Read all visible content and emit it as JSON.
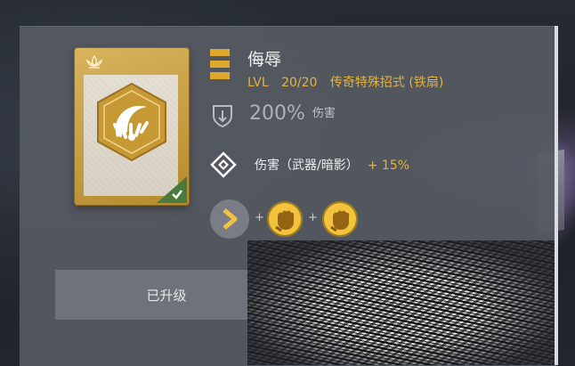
{
  "skill": {
    "name": "侮辱",
    "level_text": "LVL",
    "level_value": "20/20",
    "category": "传奇特殊招式 (铁扇)",
    "damage_value": "200%",
    "damage_label": "伤害",
    "bonus_label": "伤害（武器/暗影）",
    "bonus_value": "+ 15%"
  },
  "combo": {
    "plus": "+"
  },
  "actions": {
    "upgrade_label": "已升级"
  },
  "colors": {
    "accent_gold": "#e5b23d",
    "check_green": "#4a7a3d",
    "panel": "#565a62"
  },
  "icons": {
    "card_top": "lotus-icon",
    "emblem": "fan-emblem-icon",
    "rank": "rank-bars-icon",
    "damage": "shield-icon",
    "bonus": "diamond-icon",
    "combo_start": "arrow-right-icon",
    "combo_inputs": [
      "fist-icon",
      "fist-icon"
    ],
    "owned": "checkmark-icon"
  }
}
